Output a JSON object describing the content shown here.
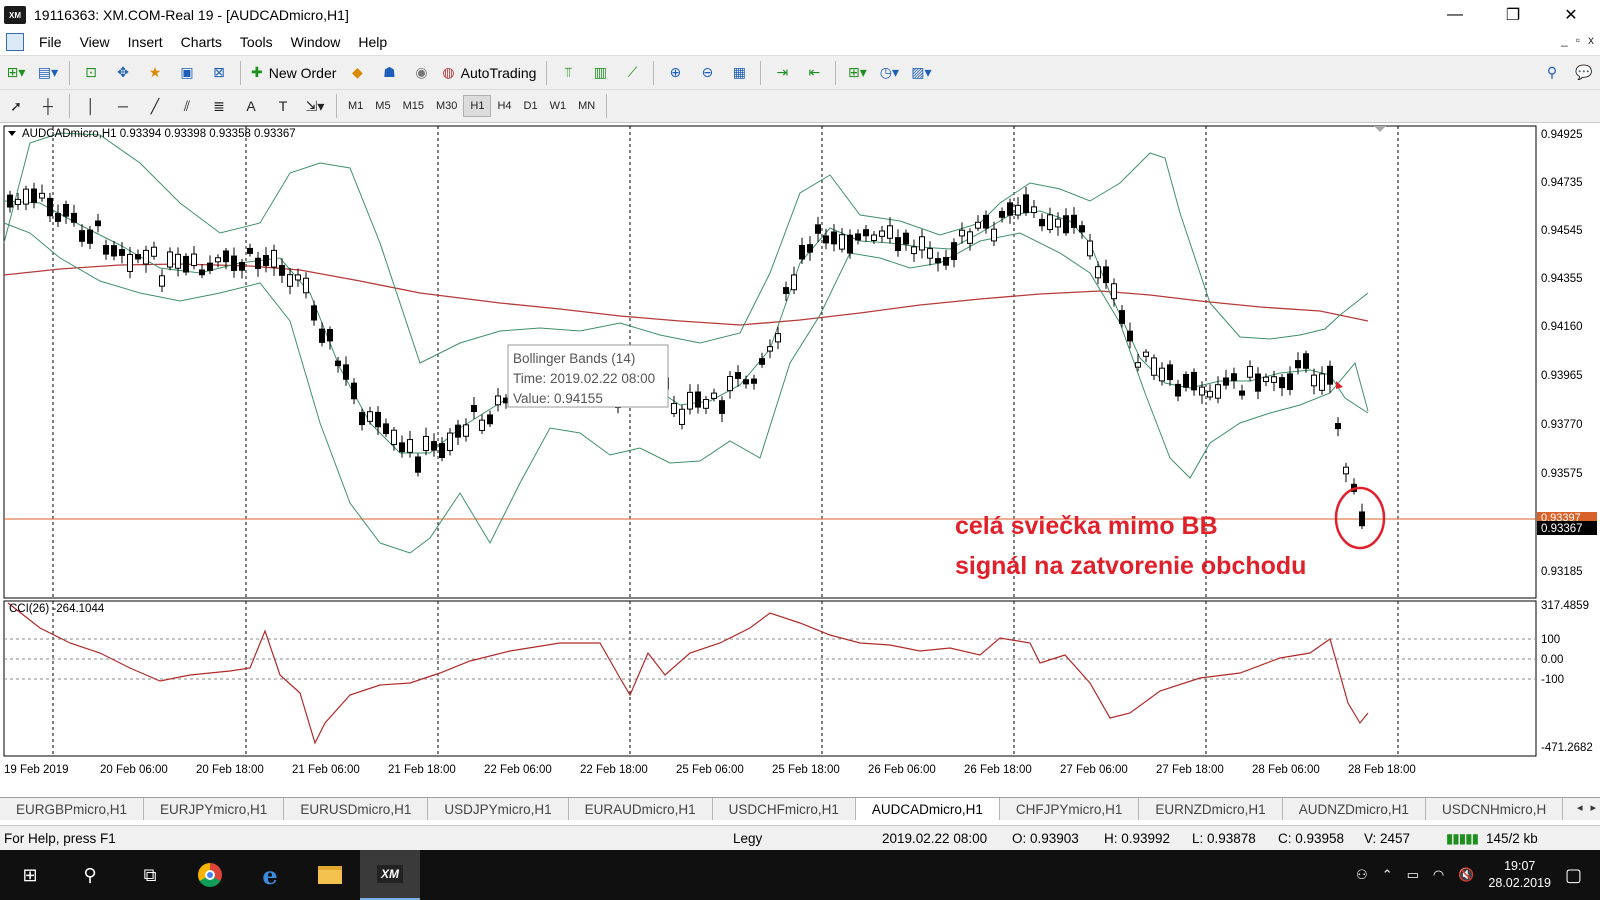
{
  "window": {
    "title": "19116363: XM.COM-Real 19 - [AUDCADmicro,H1]",
    "app_logo": "XM",
    "controls": {
      "minimize": "—",
      "maximize": "❐",
      "close": "✕"
    }
  },
  "menu": {
    "items": [
      "File",
      "View",
      "Insert",
      "Charts",
      "Tools",
      "Window",
      "Help"
    ],
    "mdi_controls": [
      "_",
      "▫",
      "x"
    ]
  },
  "toolbar": {
    "new_order_label": "New Order",
    "autotrading_label": "AutoTrading",
    "timeframes": [
      "M1",
      "M5",
      "M15",
      "M30",
      "H1",
      "H4",
      "D1",
      "W1",
      "MN"
    ],
    "active_timeframe": "H1"
  },
  "chart": {
    "header": "AUDCADmicro,H1  0.93394 0.93398 0.93358 0.93367",
    "price_labels": [
      "0.94925",
      "0.94735",
      "0.94545",
      "0.94355",
      "0.94160",
      "0.93965",
      "0.93770",
      "0.93575",
      "0.93185"
    ],
    "current_price_label": "0.93367",
    "ask_price_label": "0.93397",
    "cci_header": "CCI(26) -264.1044",
    "cci_labels": [
      "317.4859",
      "100",
      "0.00",
      "-100",
      "-471.2682"
    ],
    "time_labels": [
      "19 Feb 2019",
      "20 Feb 06:00",
      "20 Feb 18:00",
      "21 Feb 06:00",
      "21 Feb 18:00",
      "22 Feb 06:00",
      "22 Feb 18:00",
      "25 Feb 06:00",
      "25 Feb 18:00",
      "26 Feb 06:00",
      "26 Feb 18:00",
      "27 Feb 06:00",
      "27 Feb 18:00",
      "28 Feb 06:00",
      "28 Feb 18:00"
    ],
    "tooltip": {
      "line1": "Bollinger Bands (14)",
      "line2": "Time: 2019.02.22 08:00",
      "line3": "Value: 0.94155"
    },
    "annotation_line1": "celá sviečka mimo BB",
    "annotation_line2": "signál na zatvorenie obchodu",
    "colors": {
      "annotation": "#e0202a",
      "ma": "#b63a3a",
      "bands": "#3f8f6a",
      "cci": "#b12a2a",
      "price_line": "#d9622b"
    }
  },
  "tabs": {
    "items": [
      "EURGBPmicro,H1",
      "EURJPYmicro,H1",
      "EURUSDmicro,H1",
      "USDJPYmicro,H1",
      "EURAUDmicro,H1",
      "USDCHFmicro,H1",
      "AUDCADmicro,H1",
      "CHFJPYmicro,H1",
      "EURNZDmicro,H1",
      "AUDNZDmicro,H1",
      "USDCNHmicro,H"
    ],
    "active": "AUDCADmicro,H1",
    "arrows": [
      "◂",
      "▸"
    ]
  },
  "status": {
    "help": "For Help, press F1",
    "profile": "Legy",
    "time": "2019.02.22 08:00",
    "open": "O: 0.93903",
    "high": "H: 0.93992",
    "low": "L: 0.93878",
    "close": "C: 0.93958",
    "volume": "V: 2457",
    "traffic": "145/2 kb"
  },
  "taskbar": {
    "time": "19:07",
    "date": "28.02.2019",
    "active_app": "XM"
  }
}
